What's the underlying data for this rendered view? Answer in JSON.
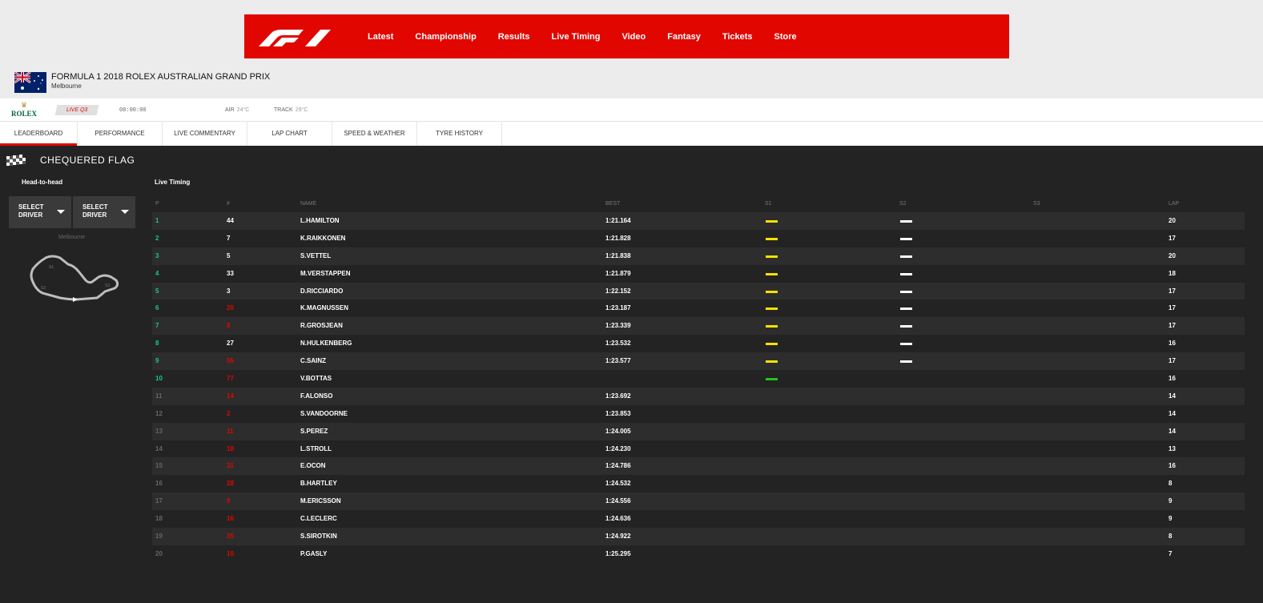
{
  "nav": {
    "logo": "F1",
    "items": [
      "Latest",
      "Championship",
      "Results",
      "Live Timing",
      "Video",
      "Fantasy",
      "Tickets",
      "Store"
    ]
  },
  "race": {
    "title": "FORMULA 1 2018 ROLEX AUSTRALIAN GRAND PRIX",
    "location": "Melbourne"
  },
  "session": {
    "sponsor": "ROLEX",
    "live_badge": "LIVE Q3",
    "clock": "00:00:00",
    "air_label": "AIR",
    "air_value": "24°C",
    "track_label": "TRACK",
    "track_value": "29°C"
  },
  "tabs": [
    "LEADERBOARD",
    "PERFORMANCE",
    "LIVE COMMENTARY",
    "LAP CHART",
    "SPEED & WEATHER",
    "TYRE HISTORY"
  ],
  "status": {
    "text": "CHEQUERED FLAG"
  },
  "h2h": {
    "title": "Head-to-head",
    "select1": "SELECT DRIVER",
    "select2": "SELECT DRIVER",
    "circuit_name": "Melbourne",
    "sector_labels": [
      "S1",
      "S2",
      "S3"
    ]
  },
  "timing": {
    "title": "Live Timing",
    "columns": {
      "p": "P",
      "num": "#",
      "name": "NAME",
      "best": "BEST",
      "s1": "S1",
      "s2": "S2",
      "s3": "S3",
      "lap": "LAP"
    },
    "rows": [
      {
        "p": "1",
        "num": "44",
        "name": "L.HAMILTON",
        "best": "1:21.164",
        "s1": "yellow",
        "s2": "white",
        "lap": "20",
        "in": true,
        "numColor": "white"
      },
      {
        "p": "2",
        "num": "7",
        "name": "K.RAIKKONEN",
        "best": "1:21.828",
        "s1": "yellow",
        "s2": "white",
        "lap": "17",
        "in": true,
        "numColor": "white"
      },
      {
        "p": "3",
        "num": "5",
        "name": "S.VETTEL",
        "best": "1:21.838",
        "s1": "yellow",
        "s2": "white",
        "lap": "20",
        "in": true,
        "numColor": "white"
      },
      {
        "p": "4",
        "num": "33",
        "name": "M.VERSTAPPEN",
        "best": "1:21.879",
        "s1": "yellow",
        "s2": "white",
        "lap": "18",
        "in": true,
        "numColor": "white"
      },
      {
        "p": "5",
        "num": "3",
        "name": "D.RICCIARDO",
        "best": "1:22.152",
        "s1": "yellow",
        "s2": "white",
        "lap": "17",
        "in": true,
        "numColor": "white"
      },
      {
        "p": "6",
        "num": "20",
        "name": "K.MAGNUSSEN",
        "best": "1:23.187",
        "s1": "yellow",
        "s2": "white",
        "lap": "17",
        "in": true,
        "numColor": "red"
      },
      {
        "p": "7",
        "num": "8",
        "name": "R.GROSJEAN",
        "best": "1:23.339",
        "s1": "yellow",
        "s2": "white",
        "lap": "17",
        "in": true,
        "numColor": "red"
      },
      {
        "p": "8",
        "num": "27",
        "name": "N.HULKENBERG",
        "best": "1:23.532",
        "s1": "yellow",
        "s2": "white",
        "lap": "16",
        "in": true,
        "numColor": "white"
      },
      {
        "p": "9",
        "num": "55",
        "name": "C.SAINZ",
        "best": "1:23.577",
        "s1": "yellow",
        "s2": "white",
        "lap": "17",
        "in": true,
        "numColor": "red"
      },
      {
        "p": "10",
        "num": "77",
        "name": "V.BOTTAS",
        "best": "",
        "s1": "green",
        "s2": "",
        "lap": "16",
        "in": true,
        "numColor": "red"
      },
      {
        "p": "11",
        "num": "14",
        "name": "F.ALONSO",
        "best": "1:23.692",
        "s1": "",
        "s2": "",
        "lap": "14",
        "in": false,
        "numColor": "red"
      },
      {
        "p": "12",
        "num": "2",
        "name": "S.VANDOORNE",
        "best": "1:23.853",
        "s1": "",
        "s2": "",
        "lap": "14",
        "in": false,
        "numColor": "red"
      },
      {
        "p": "13",
        "num": "11",
        "name": "S.PEREZ",
        "best": "1:24.005",
        "s1": "",
        "s2": "",
        "lap": "14",
        "in": false,
        "numColor": "red"
      },
      {
        "p": "14",
        "num": "18",
        "name": "L.STROLL",
        "best": "1:24.230",
        "s1": "",
        "s2": "",
        "lap": "13",
        "in": false,
        "numColor": "red"
      },
      {
        "p": "15",
        "num": "31",
        "name": "E.OCON",
        "best": "1:24.786",
        "s1": "",
        "s2": "",
        "lap": "16",
        "in": false,
        "numColor": "red"
      },
      {
        "p": "16",
        "num": "28",
        "name": "B.HARTLEY",
        "best": "1:24.532",
        "s1": "",
        "s2": "",
        "lap": "8",
        "in": false,
        "numColor": "red"
      },
      {
        "p": "17",
        "num": "9",
        "name": "M.ERICSSON",
        "best": "1:24.556",
        "s1": "",
        "s2": "",
        "lap": "9",
        "in": false,
        "numColor": "red"
      },
      {
        "p": "18",
        "num": "16",
        "name": "C.LECLERC",
        "best": "1:24.636",
        "s1": "",
        "s2": "",
        "lap": "9",
        "in": false,
        "numColor": "red"
      },
      {
        "p": "19",
        "num": "35",
        "name": "S.SIROTKIN",
        "best": "1:24.922",
        "s1": "",
        "s2": "",
        "lap": "8",
        "in": false,
        "numColor": "red"
      },
      {
        "p": "20",
        "num": "10",
        "name": "P.GASLY",
        "best": "1:25.295",
        "s1": "",
        "s2": "",
        "lap": "7",
        "in": false,
        "numColor": "red"
      }
    ]
  },
  "colors": {
    "brand": "#e10600",
    "qualified": "#19c594",
    "sector_yellow": "#f5e100",
    "sector_green": "#1ec31e",
    "sector_white": "#ffffff"
  }
}
